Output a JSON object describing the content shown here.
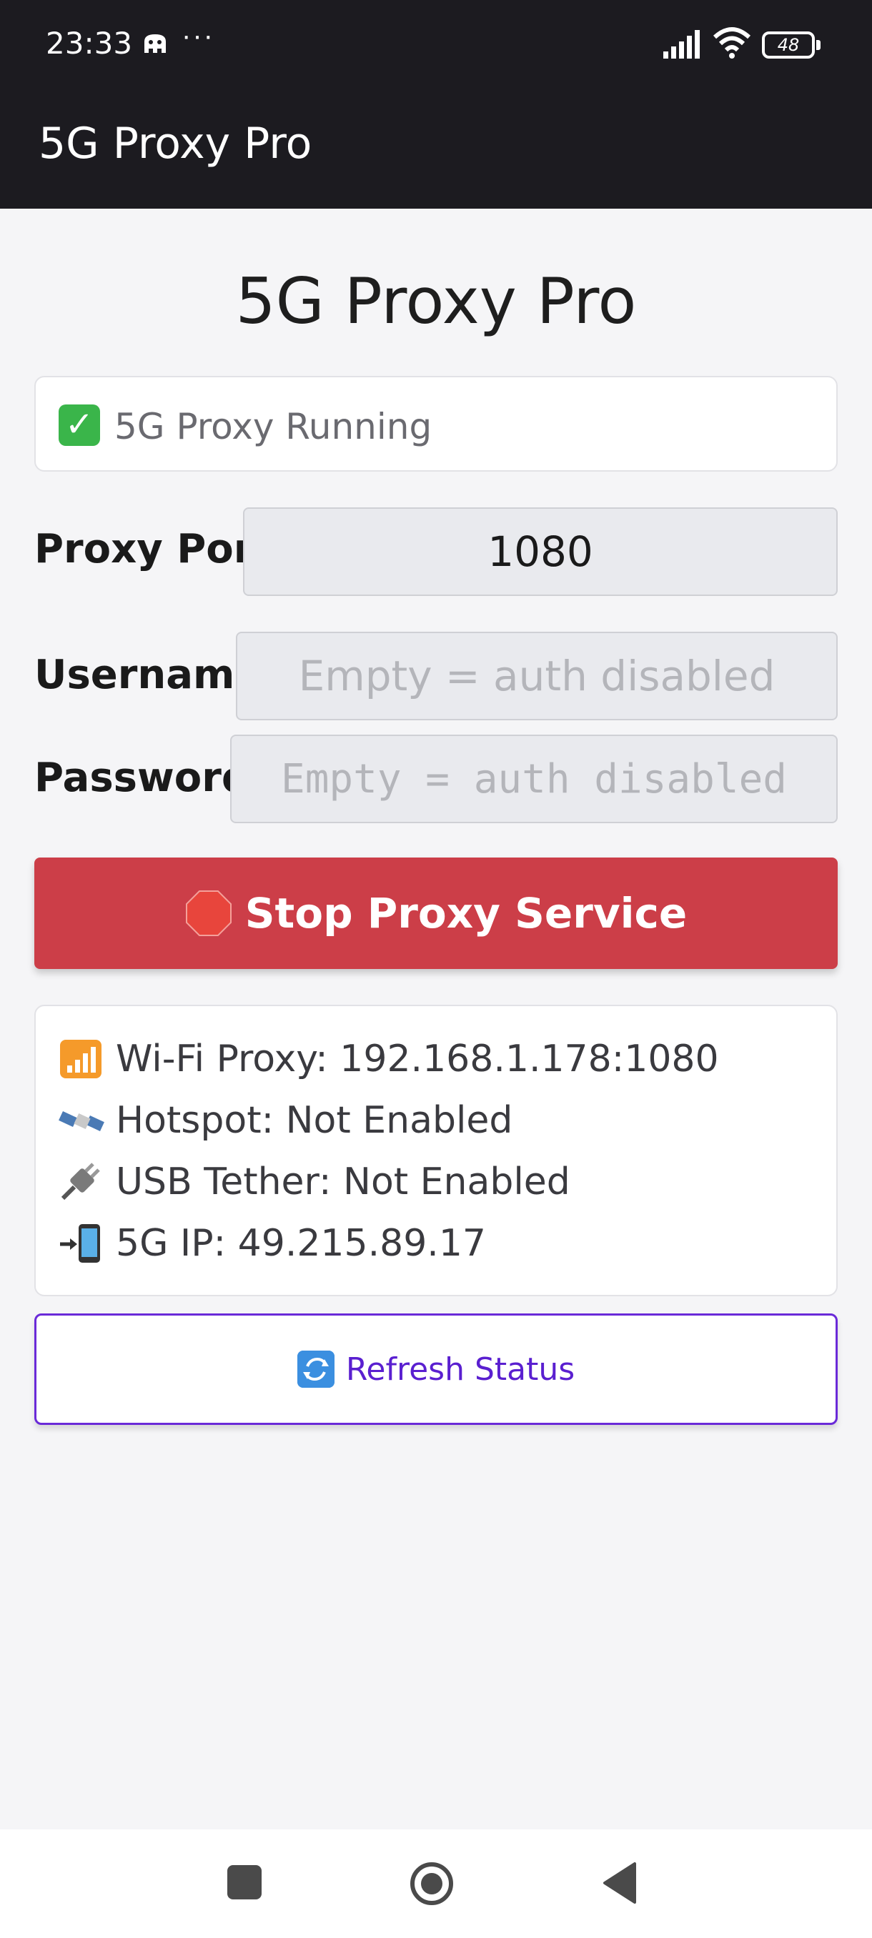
{
  "status_bar": {
    "time": "23:33",
    "dots": "···",
    "battery": "48",
    "icons": [
      "notification-icon",
      "signal-icon",
      "wifi-icon",
      "battery-icon"
    ]
  },
  "app_bar": {
    "title": "5G Proxy Pro"
  },
  "page": {
    "heading": "5G Proxy Pro",
    "status_text": "5G Proxy Running",
    "port_label": "Proxy Port:",
    "port_value": "1080",
    "username_label": "Username:",
    "username_value": "",
    "username_placeholder": "Empty = auth disabled",
    "password_label": "Password:",
    "password_value": "",
    "password_placeholder": "Empty = auth disabled",
    "stop_button_label": "Stop Proxy Service",
    "info": {
      "wifi_proxy": "Wi-Fi Proxy: 192.168.1.178:1080",
      "hotspot": "Hotspot: Not Enabled",
      "usb_tether": "USB Tether: Not Enabled",
      "ip": "5G IP: 49.215.89.17"
    },
    "refresh_button_label": "Refresh Status"
  },
  "colors": {
    "app_bar": "#1c1b20",
    "stop_button": "#cc3e48",
    "refresh_accent": "#5a1fd0",
    "status_ok": "#3ab54a"
  }
}
